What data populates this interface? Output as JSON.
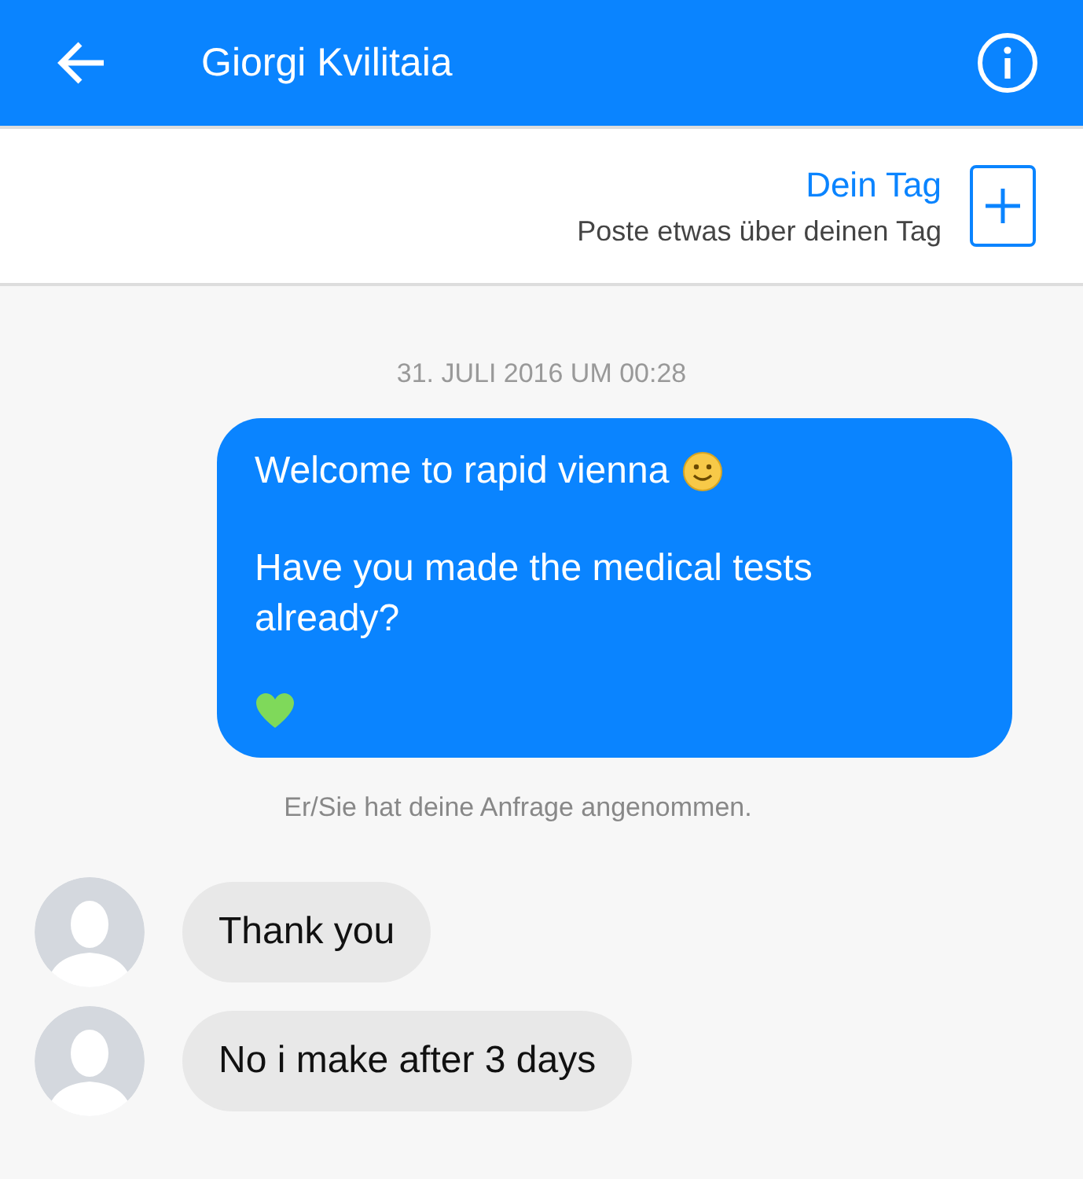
{
  "header": {
    "title": "Giorgi Kvilitaia"
  },
  "story": {
    "title": "Dein Tag",
    "subtitle": "Poste etwas über deinen Tag"
  },
  "timestamp": "31. JULI 2016 UM 00:28",
  "outgoing": {
    "paragraphs": [
      {
        "text": "Welcome to rapid vienna",
        "kind": "smiley"
      },
      {
        "text": "Have you made the medical tests already?"
      },
      {
        "kind": "heart"
      }
    ]
  },
  "notice": "Er/Sie hat deine Anfrage angenommen.",
  "incoming": [
    {
      "text": "Thank you"
    },
    {
      "text": "No i make after 3 days"
    }
  ]
}
